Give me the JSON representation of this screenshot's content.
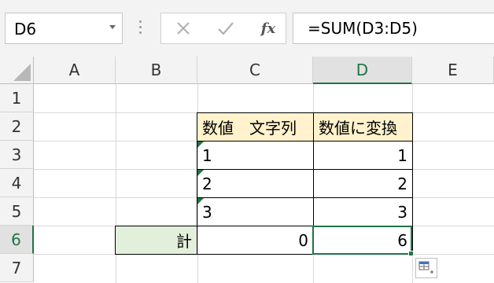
{
  "name_box": {
    "value": "D6"
  },
  "formula_bar": {
    "fx_label": "fx",
    "formula": "=SUM(D3:D5)"
  },
  "columns": [
    "A",
    "B",
    "C",
    "D",
    "E"
  ],
  "selected_column": "D",
  "rows": [
    "1",
    "2",
    "3",
    "4",
    "5",
    "6",
    "7"
  ],
  "selected_row": "6",
  "cells": {
    "C2": "数値　文字列",
    "D2": "数値に変換",
    "C3": "1",
    "C4": "2",
    "C5": "3",
    "D3": "1",
    "D4": "2",
    "D5": "3",
    "B6": "計",
    "C6": "0",
    "D6": "6"
  },
  "colors": {
    "accent": "#217346",
    "header_fill": "#fff2cc",
    "total_fill": "#e2efda"
  }
}
